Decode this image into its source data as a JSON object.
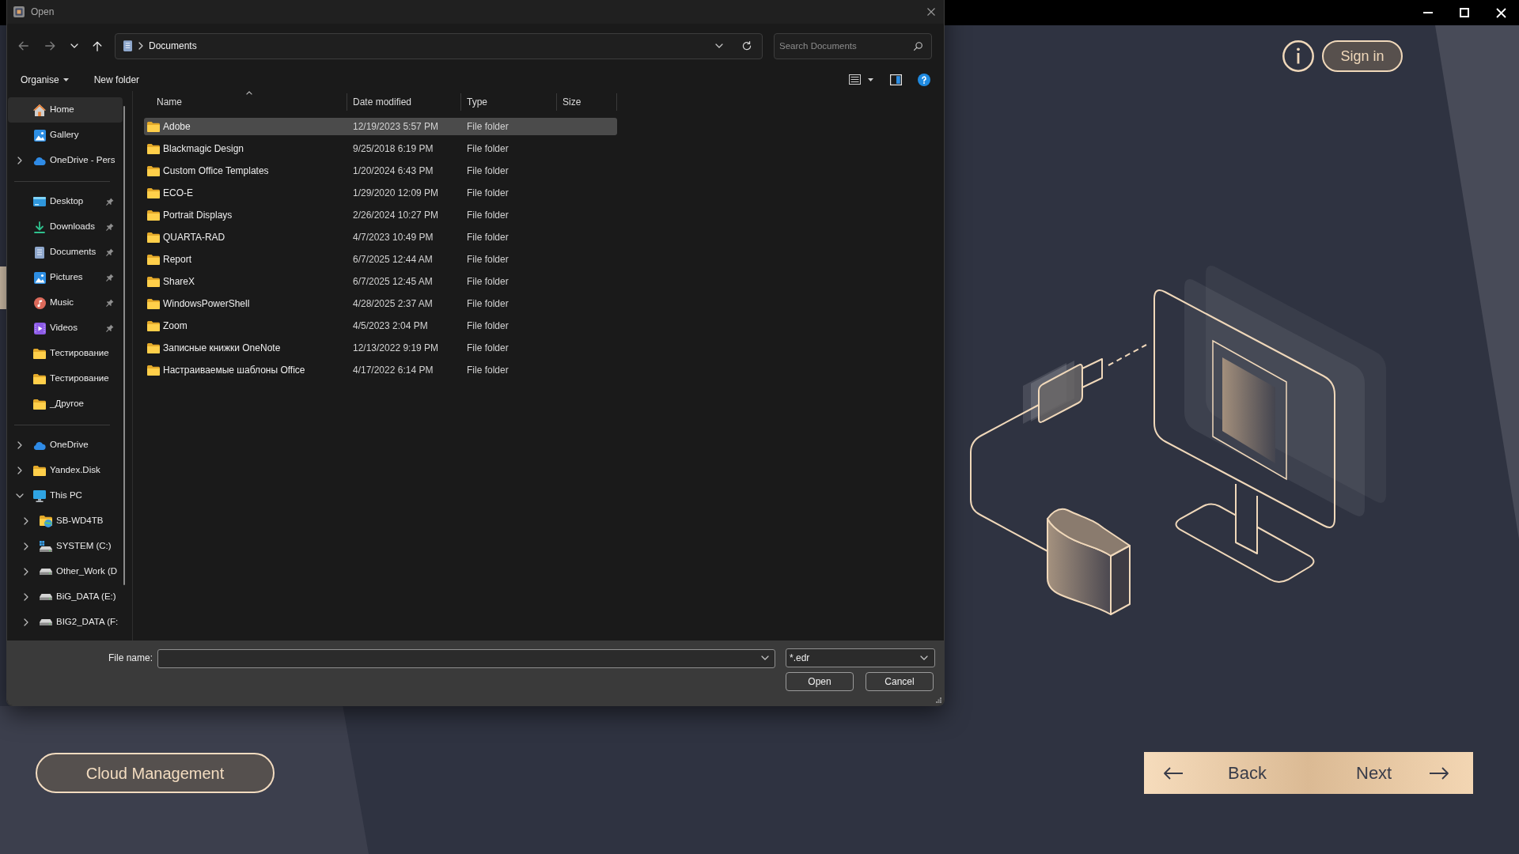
{
  "dialog": {
    "title": "Open",
    "nav_buttons": [
      {
        "kind": "back",
        "disabled": true
      },
      {
        "kind": "forward",
        "disabled": true
      },
      {
        "kind": "recent",
        "disabled": false
      },
      {
        "kind": "up",
        "disabled": false
      }
    ],
    "address": {
      "path": [
        "Documents"
      ]
    },
    "search": {
      "placeholder": "Search Documents"
    },
    "commands": [
      {
        "label": "Organise",
        "kind": "menu"
      },
      {
        "label": "New folder",
        "kind": "button"
      }
    ],
    "sidebar": {
      "groups": [
        {
          "items": [
            {
              "label": "Home",
              "kind": "home",
              "selected": true
            },
            {
              "label": "Gallery",
              "kind": "gallery",
              "selected": false
            },
            {
              "label": "OneDrive - Pers",
              "kind": "cloud",
              "selected": false,
              "expanded": false
            }
          ]
        },
        {
          "items": [
            {
              "label": "Desktop",
              "kind": "desktop",
              "selected": false,
              "pinned": true
            },
            {
              "label": "Downloads",
              "kind": "downloads",
              "selected": false,
              "pinned": true
            },
            {
              "label": "Documents",
              "kind": "documents",
              "selected": false,
              "pinned": true
            },
            {
              "label": "Pictures",
              "kind": "pictures",
              "selected": false,
              "pinned": true
            },
            {
              "label": "Music",
              "kind": "music",
              "selected": false,
              "pinned": true
            },
            {
              "label": "Videos",
              "kind": "videos",
              "selected": false,
              "pinned": true
            },
            {
              "label": "Тестирование",
              "kind": "folder",
              "selected": false,
              "pinned": false
            },
            {
              "label": "Тестирование",
              "kind": "folder",
              "selected": false,
              "pinned": false
            },
            {
              "label": "_Другое",
              "kind": "folder",
              "selected": false,
              "pinned": false
            }
          ]
        },
        {
          "items": [
            {
              "label": "OneDrive",
              "kind": "cloud",
              "selected": false,
              "expanded": false
            },
            {
              "label": "Yandex.Disk",
              "kind": "folder",
              "selected": false,
              "expanded": false
            },
            {
              "label": "This PC",
              "kind": "computer",
              "selected": false,
              "expanded": true,
              "children": [
                {
                  "label": "SB-WD4TB",
                  "kind": "network-drive",
                  "selected": false,
                  "expanded": false
                },
                {
                  "label": "SYSTEM (C:)",
                  "kind": "system-drive",
                  "selected": false,
                  "expanded": false
                },
                {
                  "label": "Other_Work (D",
                  "kind": "drive",
                  "selected": false,
                  "expanded": false
                },
                {
                  "label": "BiG_DATA (E:)",
                  "kind": "drive",
                  "selected": false,
                  "expanded": false
                },
                {
                  "label": "BIG2_DATA (F:",
                  "kind": "drive",
                  "selected": false,
                  "expanded": false
                }
              ]
            }
          ]
        }
      ]
    },
    "columns": [
      {
        "label": "Name",
        "sorted": true
      },
      {
        "label": "Date modified",
        "sorted": false
      },
      {
        "label": "Type",
        "sorted": false
      },
      {
        "label": "Size",
        "sorted": false
      }
    ],
    "rows": [
      {
        "name": "Adobe",
        "date": "12/19/2023 5:57 PM",
        "type": "File folder",
        "selected": true
      },
      {
        "name": "Blackmagic Design",
        "date": "9/25/2018 6:19 PM",
        "type": "File folder",
        "selected": false
      },
      {
        "name": "Custom Office Templates",
        "date": "1/20/2024 6:43 PM",
        "type": "File folder",
        "selected": false
      },
      {
        "name": "ECO-E",
        "date": "1/29/2020 12:09 PM",
        "type": "File folder",
        "selected": false
      },
      {
        "name": "Portrait Displays",
        "date": "2/26/2024 10:27 PM",
        "type": "File folder",
        "selected": false
      },
      {
        "name": "QUARTA-RAD",
        "date": "4/7/2023 10:49 PM",
        "type": "File folder",
        "selected": false
      },
      {
        "name": "Report",
        "date": "6/7/2025 12:44 AM",
        "type": "File folder",
        "selected": false
      },
      {
        "name": "ShareX",
        "date": "6/7/2025 12:45 AM",
        "type": "File folder",
        "selected": false
      },
      {
        "name": "WindowsPowerShell",
        "date": "4/28/2025 2:37 AM",
        "type": "File folder",
        "selected": false
      },
      {
        "name": "Zoom",
        "date": "4/5/2023 2:04 PM",
        "type": "File folder",
        "selected": false
      },
      {
        "name": "Записные книжки OneNote",
        "date": "12/13/2022 9:19 PM",
        "type": "File folder",
        "selected": false
      },
      {
        "name": "Настраиваемые шаблоны Office",
        "date": "4/17/2022 6:14 PM",
        "type": "File folder",
        "selected": false
      }
    ],
    "file_name": {
      "label": "File name:"
    },
    "file_type": {
      "value": "*.edr"
    },
    "buttons": [
      "Open",
      "Cancel"
    ]
  },
  "app": {
    "sign_in": "Sign in",
    "cloud_management": "Cloud Management",
    "navigation": [
      {
        "label": "Back",
        "kind": "back"
      },
      {
        "label": "Next",
        "kind": "next"
      }
    ]
  }
}
